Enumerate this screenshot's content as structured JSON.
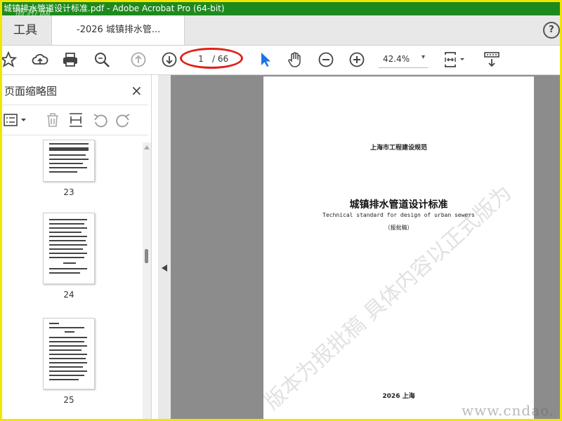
{
  "window": {
    "title": "城镇排水管道设计标准.pdf - Adobe Acrobat Pro (64-bit)",
    "watermark": "道桥网"
  },
  "tabs": {
    "tools": "工具",
    "document": "-2026 城镇排水管..."
  },
  "help_label": "?",
  "toolbar": {
    "page_current": "1",
    "page_total": "/ 66",
    "zoom": "42.4%",
    "zoom_caret": "▾"
  },
  "sidepanel": {
    "title": "页面缩略图",
    "close": "×",
    "thumbnails": [
      {
        "page": "23"
      },
      {
        "page": "24"
      },
      {
        "page": "25"
      }
    ]
  },
  "document_page": {
    "issuer": "上海市工程建设规范",
    "title": "城镇排水管道设计标准",
    "subtitle": "Technical standard for design of urban sewers",
    "status": "（报批稿）",
    "footer": "2026  上海",
    "watermark": "版本为报批稿  具体内容以正式版为"
  },
  "site_watermark": "www.cndao.",
  "colors": {
    "title_bar": "#1e8a1e",
    "frame_border": "#f2e600",
    "annotation_circle": "#e0201a",
    "select_tool": "#1a73e8"
  },
  "icons": [
    "star-icon",
    "cloud-upload-icon",
    "print-icon",
    "zoom-search-icon",
    "page-up-icon",
    "page-down-icon",
    "select-arrow-icon",
    "hand-icon",
    "zoom-out-icon",
    "zoom-in-icon",
    "fit-page-icon",
    "scroll-mode-icon"
  ]
}
